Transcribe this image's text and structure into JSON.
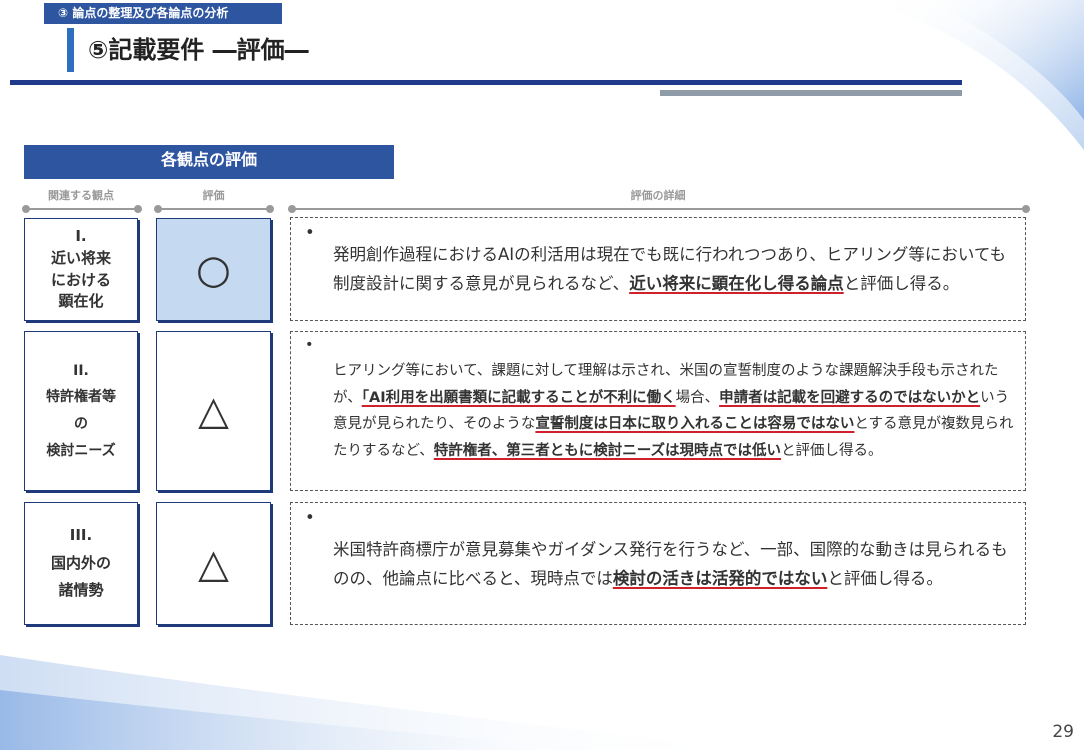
{
  "header": {
    "section_tag": "③ 論点の整理及び各論点の分析",
    "title": "⑤記載要件 ―評価―"
  },
  "section": {
    "heading": "各観点の評価"
  },
  "columns": {
    "viewpoint": "関連する観点",
    "evaluation": "評価",
    "detail": "評価の詳細"
  },
  "rows": [
    {
      "viewpoint": "I.\n近い将来\nにおける\n顕在化",
      "mark": "○",
      "detail": [
        {
          "t": "発明創作過程におけるAIの利活用は現在でも既に行われつつあり、ヒアリング等においても制度設計に関する意見が見られるなど、"
        },
        {
          "t": "近い将来に顕在化し得る論点",
          "u": true
        },
        {
          "t": "と評価し得る。"
        }
      ]
    },
    {
      "viewpoint": "II.\n特許権者等\nの\n検討ニーズ",
      "mark": "△",
      "detail": [
        {
          "t": "ヒアリング等において、課題に対して理解は示され、米国の宣誓制度のような課題解決手段も示されたが、"
        },
        {
          "t": "「AI利用を出願書類に記載することが不利に働く",
          "u": true
        },
        {
          "t": "場合、"
        },
        {
          "t": "申請者は記載を回避するのではないかと",
          "u": true
        },
        {
          "t": "いう意見が見られたり、そのような"
        },
        {
          "t": "宣誓制度は日本に取り入れることは容易ではない",
          "u": true
        },
        {
          "t": "とする意見が複数見られたりするなど、"
        },
        {
          "t": "特許権者、第三者ともに検討ニーズは現時点では低い",
          "u": true
        },
        {
          "t": "と評価し得る。"
        }
      ]
    },
    {
      "viewpoint": "III.\n国内外の\n諸情勢",
      "mark": "△",
      "detail": [
        {
          "t": "米国特許商標庁が意見募集やガイダンス発行を行うなど、一部、国際的な動きは見られるものの、他論点に比べると、現時点では"
        },
        {
          "t": "検討の活きは活発的ではない",
          "u": true
        },
        {
          "t": "と評価し得る。"
        }
      ]
    }
  ],
  "page_number": "29",
  "colors": {
    "accent": "#2d55a0",
    "rule": "#1f3a8a",
    "highlight_cell": "#c5d9f0",
    "underline": "#d0202a"
  }
}
